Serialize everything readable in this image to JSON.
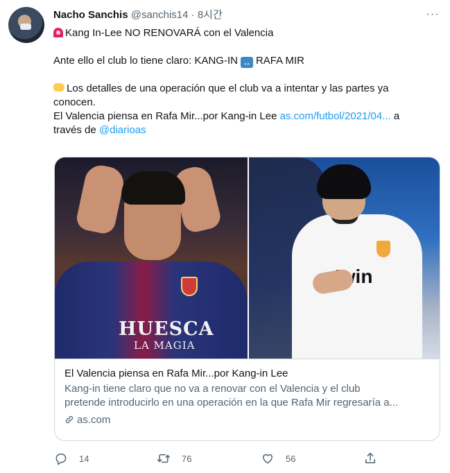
{
  "author": {
    "name": "Nacho Sanchis",
    "handle": "@sanchis14",
    "separator": "·",
    "time": "8시간"
  },
  "tweet": {
    "line1": "Kang In-Lee NO RENOVARÁ con el Valencia",
    "line2_part1": "Ante ello el club lo tiene claro: KANG-IN",
    "line2_part2": "RAFA MIR",
    "line3": "Los detalles de una operación que el club va  a intentar y las partes ya",
    "line4": "conocen.",
    "line5_text": "El Valencia piensa en Rafa Mir...por Kang-in Lee",
    "line5_link": "as.com/futbol/2021/04...",
    "line5_suffix": "a",
    "line6_prefix": "través de",
    "line6_mention": "@diarioas"
  },
  "card": {
    "image_left_text1": "HUESCA",
    "image_left_text2": "LA MAGIA",
    "image_right_text": "Iwin",
    "title": "El Valencia piensa en Rafa Mir...por Kang-in Lee",
    "desc_line1": "Kang-in tiene claro que no va a renovar con el Valencia y el club",
    "desc_line2": "pretende introducirlo en una operación en la que Rafa Mir regresaría a...",
    "domain": "as.com"
  },
  "actions": {
    "reply_count": "14",
    "retweet_count": "76",
    "like_count": "56"
  },
  "colors": {
    "accent": "#1d9bf0",
    "secondary_text": "#536471",
    "border": "#cfd9de"
  }
}
